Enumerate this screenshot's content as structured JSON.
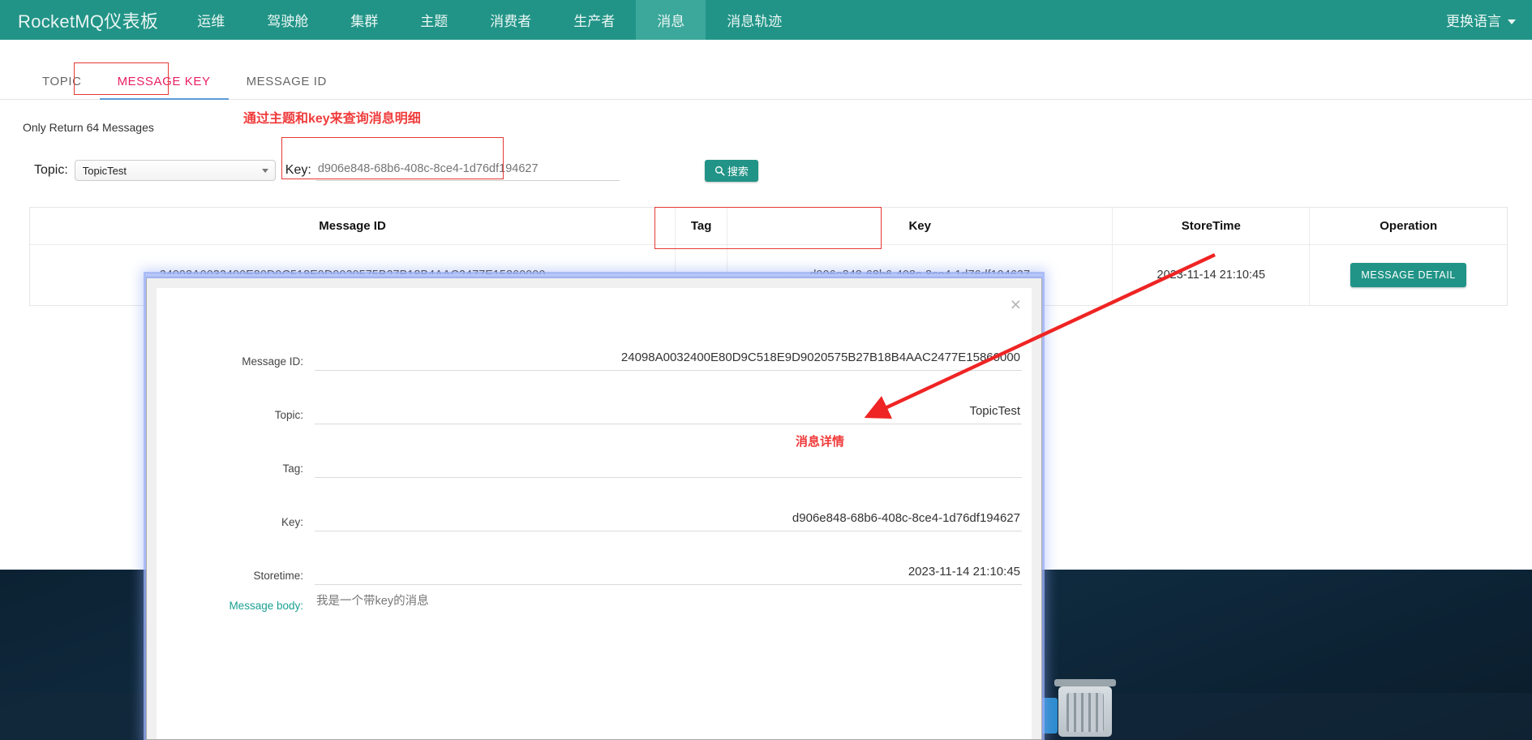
{
  "nav": {
    "brand": "RocketMQ仪表板",
    "items": [
      {
        "label": "运维",
        "active": false
      },
      {
        "label": "驾驶舱",
        "active": false
      },
      {
        "label": "集群",
        "active": false
      },
      {
        "label": "主题",
        "active": false
      },
      {
        "label": "消费者",
        "active": false
      },
      {
        "label": "生产者",
        "active": false
      },
      {
        "label": "消息",
        "active": true
      },
      {
        "label": "消息轨迹",
        "active": false
      }
    ],
    "language": "更换语言"
  },
  "tabs": [
    {
      "label": "TOPIC",
      "active": false
    },
    {
      "label": "MESSAGE KEY",
      "active": true
    },
    {
      "label": "MESSAGE ID",
      "active": false
    }
  ],
  "notice": "Only Return 64 Messages",
  "annotations": {
    "search_hint": "通过主题和key来查询消息明细",
    "detail_hint": "消息详情"
  },
  "search": {
    "topic_label": "Topic:",
    "topic_value": "TopicTest",
    "key_label": "Key:",
    "key_placeholder": "d906e848-68b6-408c-8ce4-1d76df194627",
    "key_value": "",
    "search_button": "搜索",
    "search_icon": "search-icon"
  },
  "table": {
    "columns": [
      "Message ID",
      "Tag",
      "Key",
      "StoreTime",
      "Operation"
    ],
    "rows": [
      {
        "message_id": "24098A0032400E80D9C518E9D9020575B27B18B4AAC2477E15860000",
        "tag": "",
        "key": "d906e848-68b6-408c-8ce4-1d76df194627",
        "store_time": "2023-11-14 21:10:45",
        "operation": "MESSAGE DETAIL"
      }
    ]
  },
  "modal": {
    "close_label": "×",
    "fields": [
      {
        "label": "Message ID:",
        "value": "24098A0032400E80D9C518E9D9020575B27B18B4AAC2477E15860000"
      },
      {
        "label": "Topic:",
        "value": "TopicTest"
      },
      {
        "label": "Tag:",
        "value": ""
      },
      {
        "label": "Key:",
        "value": "d906e848-68b6-408c-8ce4-1d76df194627"
      },
      {
        "label": "Storetime:",
        "value": "2023-11-14 21:10:45"
      }
    ],
    "body_label": "Message body:",
    "body_value": "我是一个带key的消息"
  }
}
